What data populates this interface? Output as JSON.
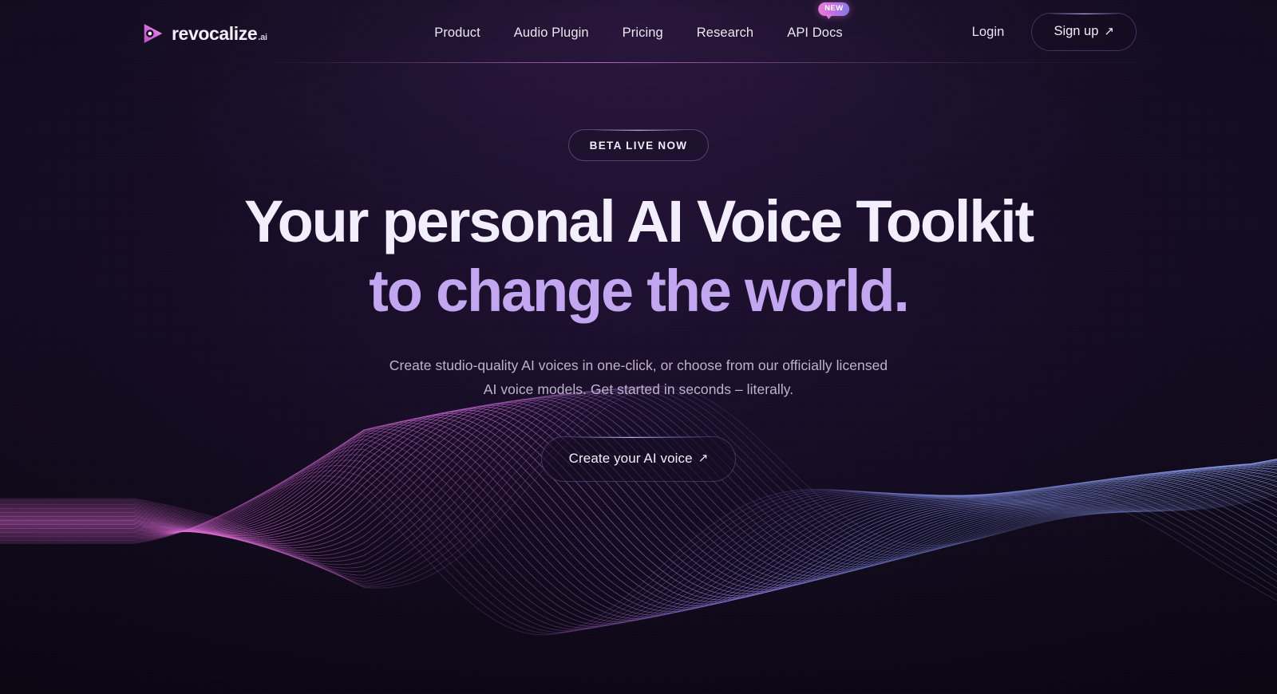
{
  "meta": {
    "background_color": "#120b1e",
    "accent_pink": "#e07ad9",
    "accent_purple": "#c2a7f0",
    "accent_blue": "#7f8ee8"
  },
  "header": {
    "logo": {
      "icon": "play-triangle-icon",
      "name": "revocalize",
      "suffix": ".ai"
    },
    "nav": [
      {
        "label": "Product"
      },
      {
        "label": "Audio Plugin"
      },
      {
        "label": "Pricing"
      },
      {
        "label": "Research"
      },
      {
        "label": "API Docs",
        "badge": "NEW"
      }
    ],
    "login_label": "Login",
    "signup_label": "Sign up",
    "signup_arrow": "↗"
  },
  "hero": {
    "badge": "BETA LIVE NOW",
    "headline_line1": "Your personal AI Voice Toolkit",
    "headline_line2": "to change the world.",
    "subtitle_line1": "Create studio-quality AI voices in one-click, or choose from our officially licensed",
    "subtitle_line2": "AI voice models. Get started in seconds – literally.",
    "cta_label": "Create your AI voice",
    "cta_arrow": "↗"
  },
  "wave": {
    "name": "audio-waveform-visual",
    "description": "Layered sine ribbon fading from magenta on the left to periwinkle blue on the right",
    "color_start": "#e06ad8",
    "color_mid": "#9a79e0",
    "color_end": "#7f9aee",
    "line_count": 46
  }
}
